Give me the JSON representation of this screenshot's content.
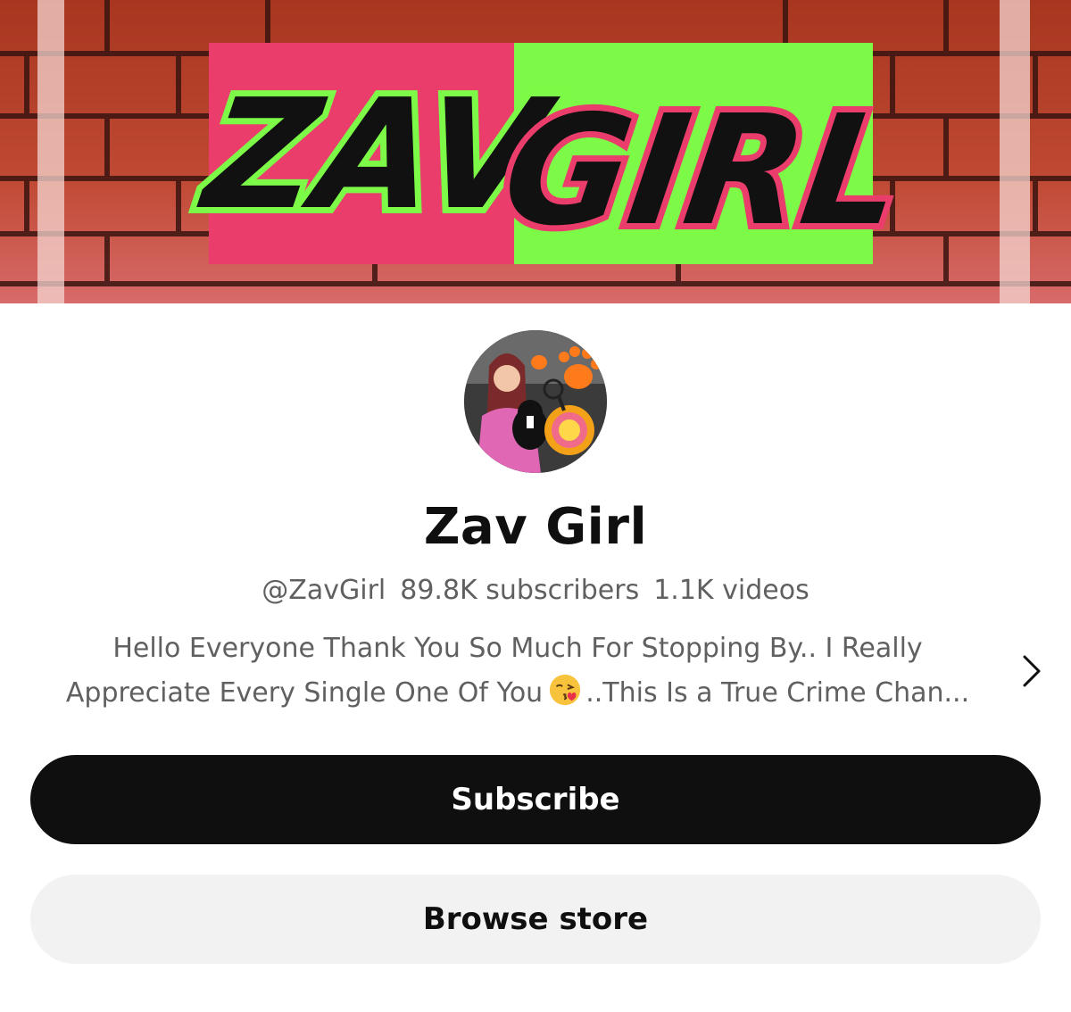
{
  "banner": {
    "logo_left": "ZAV",
    "logo_right": "GIRL",
    "colors": {
      "pink": "#ea3d6c",
      "green": "#7cfa47",
      "brick": "#b8402c"
    }
  },
  "channel": {
    "name": "Zav Girl",
    "handle": "@ZavGirl",
    "subscribers": "89.8K subscribers",
    "videos": "1.1K videos"
  },
  "description": {
    "line1": "Hello Everyone Thank You So Much For Stopping By.. I Really",
    "line2_before_emoji": "Appreciate Every Single One Of You",
    "emoji": "kissing-face-emoji",
    "line2_after_emoji": "..This Is a True Crime Chan..."
  },
  "icons": {
    "description_more": "chevron-right-icon"
  },
  "buttons": {
    "subscribe": "Subscribe",
    "browse_store": "Browse store"
  }
}
